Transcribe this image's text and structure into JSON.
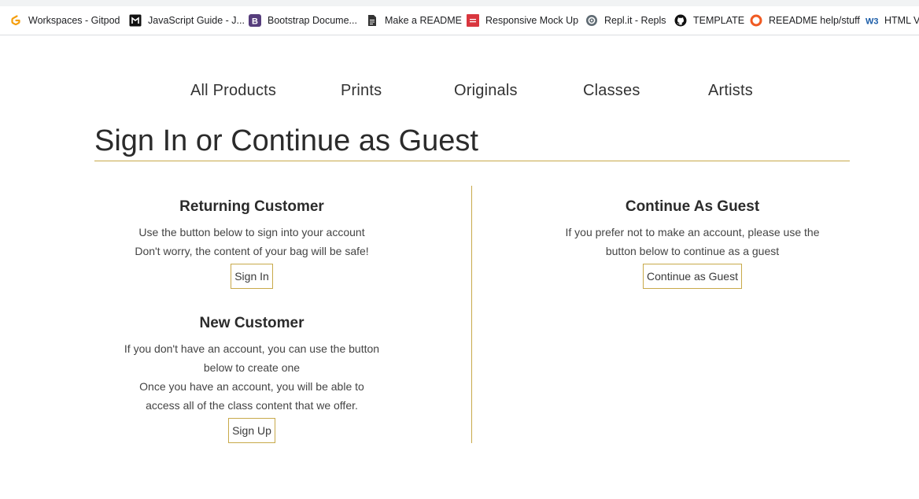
{
  "bookmarks": [
    {
      "label": "Workspaces - Gitpod",
      "icon": "gitpod-icon"
    },
    {
      "label": "JavaScript Guide - J...",
      "icon": "mdn-icon"
    },
    {
      "label": "Bootstrap Docume...",
      "icon": "bootstrap-icon"
    },
    {
      "label": "Make a README",
      "icon": "document-icon"
    },
    {
      "label": "Responsive Mock Up",
      "icon": "mockup-icon"
    },
    {
      "label": "Repl.it - Repls",
      "icon": "replit-icon"
    },
    {
      "label": "TEMPLATE",
      "icon": "github-icon"
    },
    {
      "label": "REEADME help/stuff",
      "icon": "circle-icon"
    },
    {
      "label": "HTML Va",
      "icon": "w3-icon"
    }
  ],
  "nav": {
    "items": [
      "All Products",
      "Prints",
      "Originals",
      "Classes",
      "Artists"
    ]
  },
  "page": {
    "title": "Sign In or Continue as Guest"
  },
  "returning": {
    "heading": "Returning Customer",
    "line1": "Use the button below to sign into your account",
    "line2": "Don't worry, the content of your bag will be safe!",
    "button": "Sign In"
  },
  "new_customer": {
    "heading": "New Customer",
    "line1": "If you don't have an account, you can use the button",
    "line2": "below to create one",
    "line3": "Once you have an account, you will be able to",
    "line4": "access all of the class content that we offer.",
    "button": "Sign Up"
  },
  "guest": {
    "heading": "Continue As Guest",
    "line1": "If you prefer not to make an account, please use the",
    "line2": "button below to continue as a guest",
    "button": "Continue as Guest"
  },
  "colors": {
    "accent": "#c8a94a",
    "text": "#3a3a3a",
    "background": "#ffffff"
  }
}
